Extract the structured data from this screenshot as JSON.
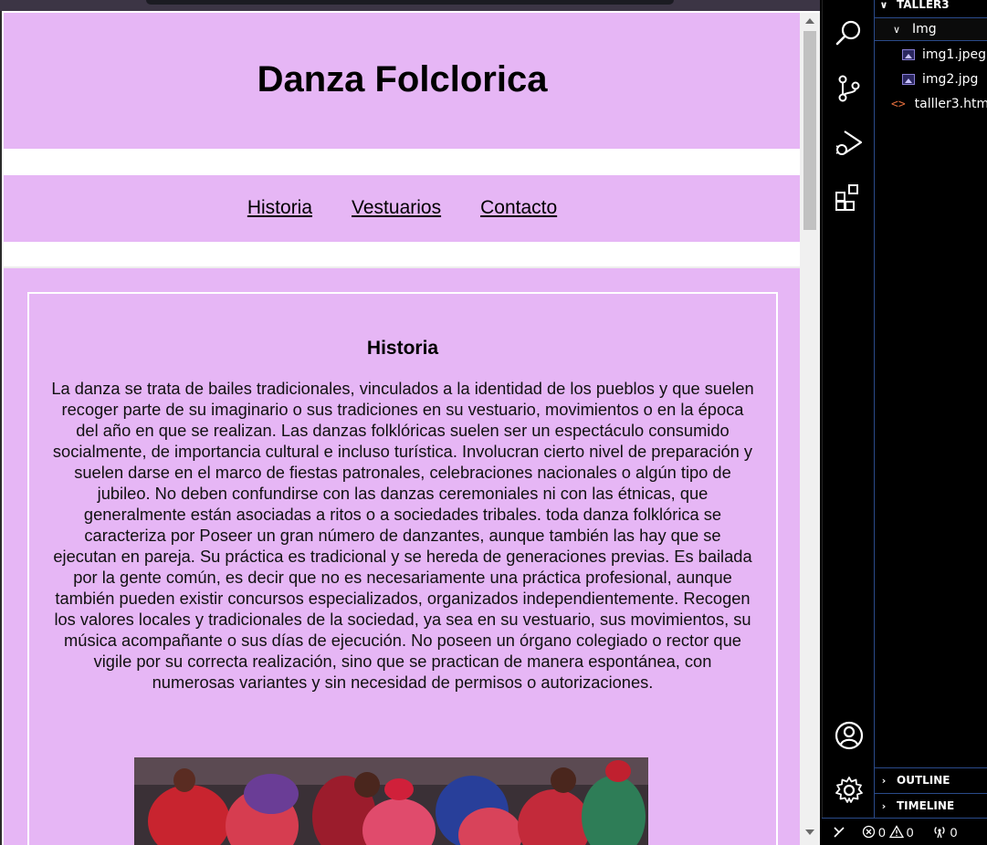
{
  "preview": {
    "page_title": "Danza Folclorica",
    "nav": [
      "Historia",
      "Vestuarios",
      "Contacto"
    ],
    "section_title": "Historia",
    "section_text": "La danza se trata de bailes tradicionales, vinculados a la identidad de los pueblos y que suelen recoger parte de su imaginario o sus tradiciones en su vestuario, movimientos o en la época del año en que se realizan. Las danzas folklóricas suelen ser un espectáculo consumido socialmente, de importancia cultural e incluso turística. Involucran cierto nivel de preparación y suelen darse en el marco de fiestas patronales, celebraciones nacionales o algún tipo de jubileo. No deben confundirse con las danzas ceremoniales ni con las étnicas, que generalmente están asociadas a ritos o a sociedades tribales. toda danza folklórica se caracteriza por Poseer un gran número de danzantes, aunque también las hay que se ejecutan en pareja. Su práctica es tradicional y se hereda de generaciones previas. Es bailada por la gente común, es decir que no es necesariamente una práctica profesional, aunque también pueden existir concursos especializados, organizados independientemente. Recogen los valores locales y tradicionales de la sociedad, ya sea en su vestuario, sus movimientos, su música acompañante o sus días de ejecución. No poseen un órgano colegiado o rector que vigile por su correcta realización, sino que se practican de manera espontánea, con numerosas variantes y sin necesidad de permisos o autorizaciones.",
    "colors": {
      "panel": "#e6b6f5",
      "text": "#000000"
    }
  },
  "activity_bar": {
    "icons": [
      "search-icon",
      "source-control-icon",
      "run-debug-icon",
      "extensions-icon",
      "account-icon",
      "settings-gear-icon"
    ]
  },
  "explorer": {
    "root": "TALLER3",
    "folder": "Img",
    "files": [
      "img1.jpeg",
      "img2.jpg"
    ],
    "html_file": "talller3.html",
    "outline": "OUTLINE",
    "timeline": "TIMELINE"
  },
  "status_bar": {
    "errors": "0",
    "warnings": "0",
    "ports": "0"
  }
}
